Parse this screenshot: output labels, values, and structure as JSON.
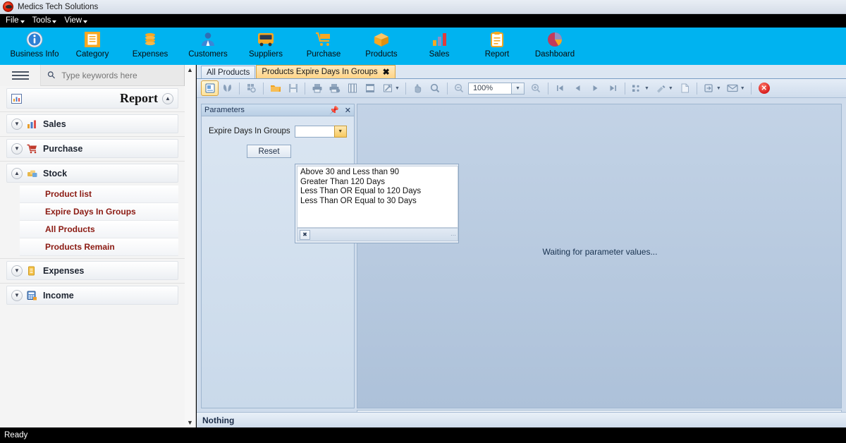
{
  "window": {
    "title": "Medics Tech Solutions",
    "logo_icon": "app-logo-icon"
  },
  "menubar": {
    "items": [
      {
        "label": "File"
      },
      {
        "label": "Tools"
      },
      {
        "label": "View"
      }
    ]
  },
  "ribbon": {
    "items": [
      {
        "label": "Business Info",
        "icon": "info-icon"
      },
      {
        "label": "Category",
        "icon": "category-icon"
      },
      {
        "label": "Expenses",
        "icon": "coins-icon"
      },
      {
        "label": "Customers",
        "icon": "person-icon"
      },
      {
        "label": "Suppliers",
        "icon": "bus-icon"
      },
      {
        "label": "Purchase",
        "icon": "cart-icon"
      },
      {
        "label": "Products",
        "icon": "box-icon"
      },
      {
        "label": "Sales",
        "icon": "bar-chart-icon"
      },
      {
        "label": "Report",
        "icon": "clipboard-icon"
      },
      {
        "label": "Dashboard",
        "icon": "pie-chart-icon"
      }
    ]
  },
  "sidebar": {
    "search_placeholder": "Type keywords here",
    "search_value": "",
    "title": "Report",
    "groups": [
      {
        "label": "Sales",
        "icon": "bar-chart-icon",
        "expanded": false
      },
      {
        "label": "Purchase",
        "icon": "cart-icon",
        "expanded": false
      },
      {
        "label": "Stock",
        "icon": "stock-icon",
        "expanded": true
      },
      {
        "label": "Expenses",
        "icon": "notepad-icon",
        "expanded": false
      },
      {
        "label": "Income",
        "icon": "calculator-icon",
        "expanded": false
      }
    ],
    "stock_items": [
      {
        "label": "Product list"
      },
      {
        "label": "Expire Days In Groups"
      },
      {
        "label": "All Products"
      },
      {
        "label": "Products Remain"
      }
    ]
  },
  "tabs": [
    {
      "label": "All Products",
      "active": false,
      "closable": false
    },
    {
      "label": "Products Expire Days In Groups",
      "active": true,
      "closable": true,
      "close_label": "✖"
    }
  ],
  "toolbar": {
    "zoom_value": "100%",
    "buttons": [
      {
        "icon": "document-map-icon",
        "selected": true
      },
      {
        "icon": "find-icon",
        "selected": false
      },
      {
        "icon": "refresh-grid-icon",
        "selected": false
      },
      {
        "icon": "open-folder-icon",
        "selected": false
      },
      {
        "icon": "save-icon",
        "selected": false
      },
      {
        "icon": "print-icon",
        "selected": false
      },
      {
        "icon": "quick-print-icon",
        "selected": false
      },
      {
        "icon": "page-setup-icon",
        "selected": false
      },
      {
        "icon": "header-footer-icon",
        "selected": false
      },
      {
        "icon": "scale-icon",
        "selected": false
      },
      {
        "icon": "hand-tool-icon",
        "selected": false
      },
      {
        "icon": "magnifier-icon",
        "selected": false
      },
      {
        "icon": "zoom-out-icon",
        "selected": false
      },
      {
        "icon": "zoom-in-icon",
        "selected": false
      },
      {
        "icon": "first-page-icon",
        "selected": false
      },
      {
        "icon": "previous-page-icon",
        "selected": false
      },
      {
        "icon": "next-page-icon",
        "selected": false
      },
      {
        "icon": "last-page-icon",
        "selected": false
      },
      {
        "icon": "multiple-pages-icon",
        "selected": false
      },
      {
        "icon": "background-color-icon",
        "selected": false
      },
      {
        "icon": "watermark-icon",
        "selected": false
      },
      {
        "icon": "export-document-icon",
        "selected": false
      },
      {
        "icon": "send-email-icon",
        "selected": false
      },
      {
        "icon": "close-preview-icon",
        "selected": false
      }
    ]
  },
  "parameters": {
    "panel_title": "Parameters",
    "pin_icon": "pin-icon",
    "close_icon": "close-icon",
    "field_label": "Expire Days In Groups",
    "field_value": "",
    "dropdown_arrow_icon": "chevron-down-icon",
    "reset_label": "Reset",
    "dropdown_options": [
      "Above 30 and Less than 90",
      "Greater Than 120 Days",
      "Less Than OR Equal to 120 Days",
      "Less Than OR Equal to 30 Days"
    ],
    "dropdown_footer_icon": "close-list-icon"
  },
  "viewer": {
    "waiting_message": "Waiting for parameter values...",
    "status_text": "Nothing"
  },
  "app_status": {
    "text": "Ready"
  },
  "colors": {
    "ribbon_bg": "#00b3f0",
    "accent_orange": "#f7a823",
    "tab_active": "#ffd488",
    "sub_item_text": "#8b1a12",
    "close_red": "#d81d1d"
  }
}
